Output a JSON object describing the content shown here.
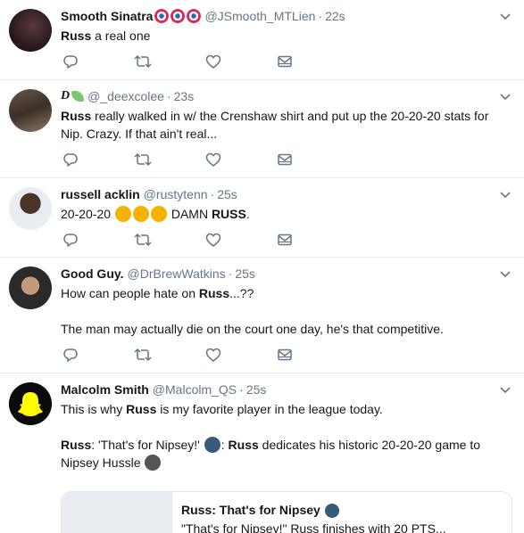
{
  "tweets": [
    {
      "name": "Smooth Sinatra",
      "handle": "@JSmooth_MTLien",
      "time": "22s",
      "text": [
        [
          {
            "t": "Russ",
            "b": true
          },
          {
            "t": " a real one"
          }
        ]
      ]
    },
    {
      "name": "D",
      "handle": "@_deexcolee",
      "time": "23s",
      "text": [
        [
          {
            "t": "Russ",
            "b": true
          },
          {
            "t": " really walked in w/ the Crenshaw shirt and put up the 20-20-20 stats for Nip. Crazy. If that ain't real..."
          }
        ]
      ]
    },
    {
      "name": "russell acklin",
      "handle": "@rustytenn",
      "time": "25s",
      "text": [
        [
          {
            "t": "20-20-20 "
          },
          {
            "e": "#f5b300"
          },
          {
            "e": "#f5b300"
          },
          {
            "e": "#f5b300"
          },
          {
            "t": " DAMN "
          },
          {
            "t": "RUSS",
            "b": true
          },
          {
            "t": "."
          }
        ]
      ]
    },
    {
      "name": "Good Guy.",
      "handle": "@DrBrewWatkins",
      "time": "25s",
      "text": [
        [
          {
            "t": "How can people hate on "
          },
          {
            "t": "Russ",
            "b": true
          },
          {
            "t": "...??"
          }
        ],
        [
          {
            "t": "The man may actually die on the court one day, he's that competitive."
          }
        ]
      ]
    },
    {
      "name": "Malcolm Smith",
      "handle": "@Malcolm_QS",
      "time": "25s",
      "text": [
        [
          {
            "t": "This is why "
          },
          {
            "t": "Russ",
            "b": true
          },
          {
            "t": " is my favorite player in the league today."
          }
        ],
        [
          {
            "t": "Russ",
            "b": true
          },
          {
            "t": ": 'That's for Nipsey!' "
          },
          {
            "e": "#3a5a7a"
          },
          {
            "t": ": "
          },
          {
            "t": "Russ",
            "b": true
          },
          {
            "t": " dedicates his historic 20-20-20 game to Nipsey Hussle "
          },
          {
            "e": "#555555"
          }
        ]
      ],
      "card": {
        "title": "Russ: That's for Nipsey",
        "desc": "\"That's for Nipsey!\" Russ finishes with 20 PTS..."
      }
    }
  ],
  "colors": {
    "icon": "#657786",
    "border": "#e6ecf0",
    "badge": "#e0245e"
  },
  "icons": {
    "reply": "reply-icon",
    "retweet": "retweet-icon",
    "like": "heart-icon",
    "dm": "envelope-icon",
    "more": "chevron-down-icon"
  }
}
